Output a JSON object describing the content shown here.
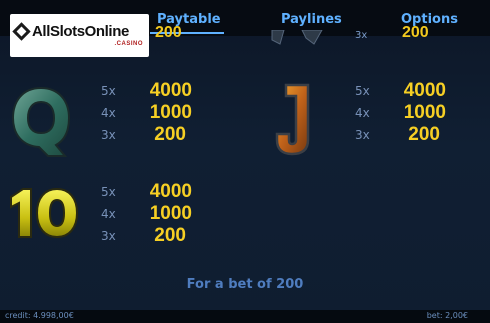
{
  "tabs": [
    {
      "label": "Paytable",
      "active": true
    },
    {
      "label": "Paylines",
      "active": false
    },
    {
      "label": "Options",
      "active": false
    }
  ],
  "logo": {
    "text": "AllSlotsOnline",
    "sub": ".CASINO"
  },
  "partial_row": {
    "left_value": "200",
    "right_multiplier": "3x",
    "right_value": "200"
  },
  "paytable": [
    {
      "symbol": "Q",
      "rows": [
        {
          "mult": "5x",
          "value": "4000"
        },
        {
          "mult": "4x",
          "value": "1000"
        },
        {
          "mult": "3x",
          "value": "200"
        }
      ]
    },
    {
      "symbol": "J",
      "rows": [
        {
          "mult": "5x",
          "value": "4000"
        },
        {
          "mult": "4x",
          "value": "1000"
        },
        {
          "mult": "3x",
          "value": "200"
        }
      ]
    },
    {
      "symbol": "10",
      "rows": [
        {
          "mult": "5x",
          "value": "4000"
        },
        {
          "mult": "4x",
          "value": "1000"
        },
        {
          "mult": "3x",
          "value": "200"
        }
      ]
    }
  ],
  "bet_info": "For a bet of 200",
  "status": {
    "credit": "credit: 4.998,00€",
    "bet": "bet: 2,00€"
  },
  "colors": {
    "tab": "#5fb1ff",
    "payout": "#f6cf24",
    "multiplier": "#7891b8",
    "background": "#0e1a2b"
  }
}
